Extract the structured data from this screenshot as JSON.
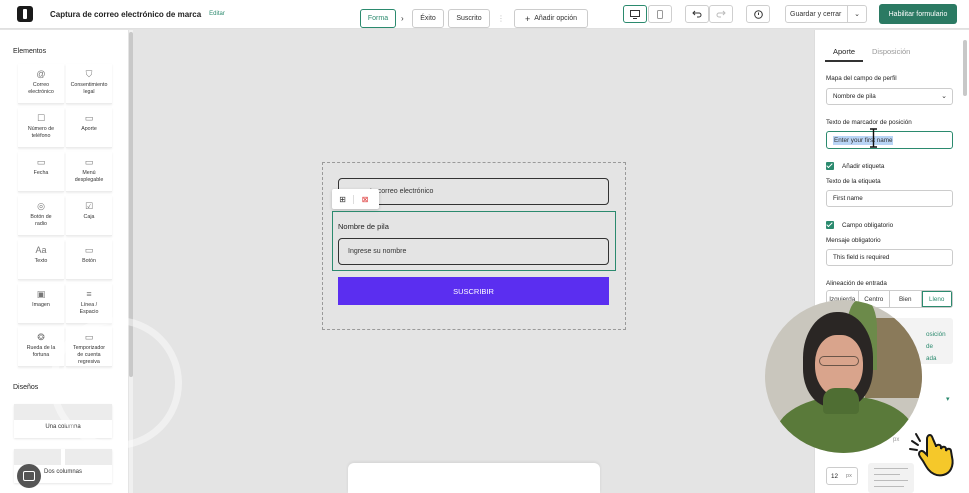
{
  "header": {
    "title": "Captura de correo electrónico de marca",
    "edit_label": "Editar",
    "save_label": "Guardar y cerrar",
    "enable_label": "Habilitar formulario",
    "icons": [
      "desktop-icon",
      "mobile-icon",
      "undo-icon",
      "redo-icon",
      "clock-icon",
      "chevron-down-icon"
    ]
  },
  "elements_panel": {
    "title": "Elementos",
    "items": [
      {
        "icon": "@",
        "label_1": "Correo",
        "label_2": "electrónico"
      },
      {
        "icon": "⛉",
        "label_1": "Consentimiento",
        "label_2": "legal"
      },
      {
        "icon": "☐",
        "label_1": "Número de",
        "label_2": "teléfono"
      },
      {
        "icon": "▭",
        "label_1": "Aporte",
        "label_2": ""
      },
      {
        "icon": "▭",
        "label_1": "Fecha",
        "label_2": ""
      },
      {
        "icon": "▭",
        "label_1": "Menú",
        "label_2": "desplegable"
      },
      {
        "icon": "◎",
        "label_1": "Botón de",
        "label_2": "radio"
      },
      {
        "icon": "☑",
        "label_1": "Caja",
        "label_2": ""
      },
      {
        "icon": "Aa",
        "label_1": "Texto",
        "label_2": ""
      },
      {
        "icon": "▭",
        "label_1": "Botón",
        "label_2": ""
      },
      {
        "icon": "▣",
        "label_1": "Imagen",
        "label_2": ""
      },
      {
        "icon": "≡",
        "label_1": "Línea /",
        "label_2": "Espacio"
      },
      {
        "icon": "❂",
        "label_1": "Rueda de la",
        "label_2": "fortuna"
      },
      {
        "icon": "▭",
        "label_1": "Temporizador",
        "label_2": "de cuenta regresiva"
      }
    ],
    "designs_title": "Diseños",
    "designs": [
      "Una columna",
      "Dos columnas"
    ]
  },
  "form": {
    "email_placeholder": "tu correo electrónico",
    "name_label": "Nombre de pila",
    "name_placeholder": "Ingrese su nombre",
    "submit_label": "SUSCRIBIR"
  },
  "steps": {
    "items": [
      "Forma",
      "Éxito",
      "Suscrito"
    ],
    "active": "Forma",
    "add_label": "Añadir opción"
  },
  "properties": {
    "tab_input": "Aporte",
    "tab_layout": "Disposición",
    "profile_map_label": "Mapa del campo de perfil",
    "profile_map_value": "Nombre de pila",
    "placeholder_label": "Texto de marcador de posición",
    "placeholder_value": "Enter your first name",
    "add_label_check": "Añadir etiqueta",
    "label_text_label": "Texto de la etiqueta",
    "label_text_value": "First name",
    "required_check": "Campo obligatorio",
    "required_msg_label": "Mensaje obligatorio",
    "required_msg_value": "This field is required",
    "align_label": "Alineación de entrada",
    "align_options": [
      "Izquierda",
      "Centro",
      "Bien",
      "Lleno"
    ],
    "align_selected": "Lleno",
    "info_line_1": "osición de",
    "info_line_2": "ada",
    "size_value": "12",
    "size_unit": "px",
    "px_ghost": "px"
  },
  "colors": {
    "accent": "#2b8a6e",
    "submit": "#5b2ef0",
    "enable_button": "#2b7a63"
  }
}
